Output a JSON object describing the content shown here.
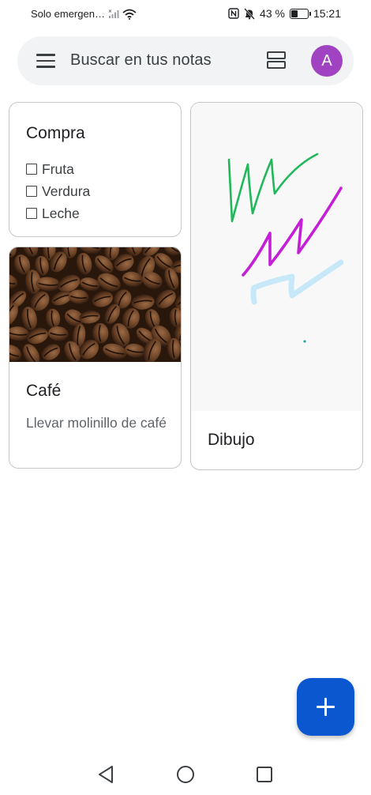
{
  "status_bar": {
    "carrier": "Solo emergen…",
    "battery": "43 %",
    "battery_level": 0.43,
    "time": "15:21"
  },
  "search": {
    "placeholder": "Buscar en tus notas",
    "avatar_letter": "A",
    "avatar_color": "#a142c2"
  },
  "notes": [
    {
      "title": "Compra",
      "items": [
        "Fruta",
        "Verdura",
        "Leche"
      ]
    },
    {
      "title": "Café",
      "body": "Llevar molinillo de café"
    },
    {
      "title": "Dibujo",
      "stroke_colors": [
        "#1fb85a",
        "#c41fd6",
        "#c6e8f8",
        "#26a69a"
      ]
    }
  ],
  "colors": {
    "accent": "#0b57d0"
  }
}
